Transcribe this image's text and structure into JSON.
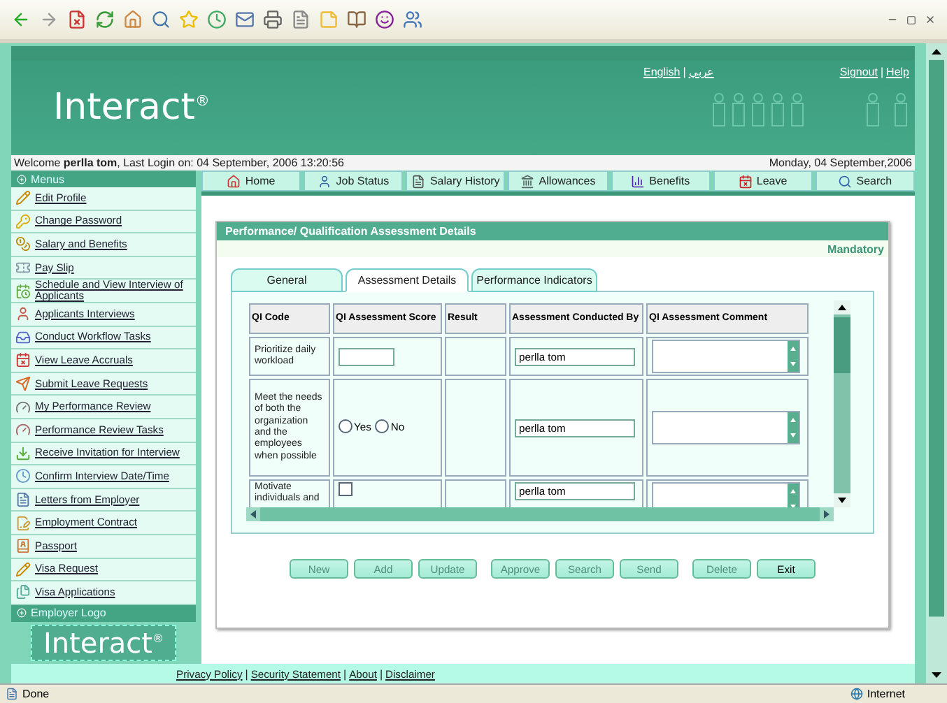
{
  "header": {
    "logo": "Interact$^{®}$",
    "separator": "|",
    "language_links": [
      "English",
      "عربي"
    ],
    "account_links": [
      "Signout",
      "Help"
    ]
  },
  "welcome": {
    "text": "Welcome **perlla tom**, Last Login on: 04 September, 2006 13:20:56",
    "date": "Monday, 04 September,2006"
  },
  "sidebar": {
    "menus_title": "Menus",
    "items": [
      "Edit Profile",
      "Change Password",
      "Salary and Benefits",
      "Pay Slip",
      "Schedule and View Interview of Applicants",
      "Applicants Interviews",
      "Conduct Workflow Tasks",
      "View Leave Accruals",
      "Submit Leave Requests",
      "My Performance Review",
      "Performance Review Tasks",
      "Receive Invitation for Interview",
      "Confirm Interview Date/Time",
      "Letters from Employer",
      "Employment Contract",
      "Passport",
      "Visa Request",
      "Visa Applications"
    ],
    "logo_title": "Employer Logo",
    "logo": "Interact$^{®}$"
  },
  "nav_tabs": [
    "Home",
    "Job Status",
    "Salary History",
    "Allowances",
    "Benefits",
    "Leave",
    "Search"
  ],
  "panel": {
    "title": "Performance/ Qualification Assessment Details",
    "mandatory": "Mandatory",
    "tabs": [
      {
        "label": "General",
        "selected": false
      },
      {
        "label": "Assessment Details",
        "selected": true
      },
      {
        "label": "Performance Indicators",
        "selected": false
      }
    ],
    "table": {
      "columns": [
        "QI Code",
        "QI Assessment Score",
        "Result",
        "Assessment Conducted By",
        "QI Assessment Comment"
      ],
      "rows": [
        {
          "code": "Prioritize daily workload",
          "kind": "text",
          "conducted_by": "perlla tom"
        },
        {
          "code": "Meet the needs of both the organization and the employees when possible",
          "kind": "radio",
          "options": [
            {
              "label": "Yes",
              "selected": false
            },
            {
              "label": "No",
              "selected": false
            }
          ],
          "conducted_by": "perlla tom"
        },
        {
          "code": "Motivate individuals and",
          "kind": "checkbox",
          "checked": false,
          "conducted_by": "perlla tom"
        }
      ]
    },
    "buttons": [
      {
        "label": "New",
        "disabled": true
      },
      {
        "label": "Add",
        "disabled": true
      },
      {
        "label": "Update",
        "disabled": true
      },
      {
        "label": "Approve",
        "disabled": true
      },
      {
        "label": "Search",
        "disabled": true
      },
      {
        "label": "Send",
        "disabled": true
      },
      {
        "label": "Delete",
        "disabled": true
      },
      {
        "label": "Exit",
        "disabled": false
      }
    ]
  },
  "footer": {
    "separator": "|",
    "links": [
      "Privacy Policy",
      "Security Statement",
      "About",
      "Disclaimer"
    ]
  },
  "status_bar": {
    "status": "Done",
    "zone": "Internet"
  }
}
